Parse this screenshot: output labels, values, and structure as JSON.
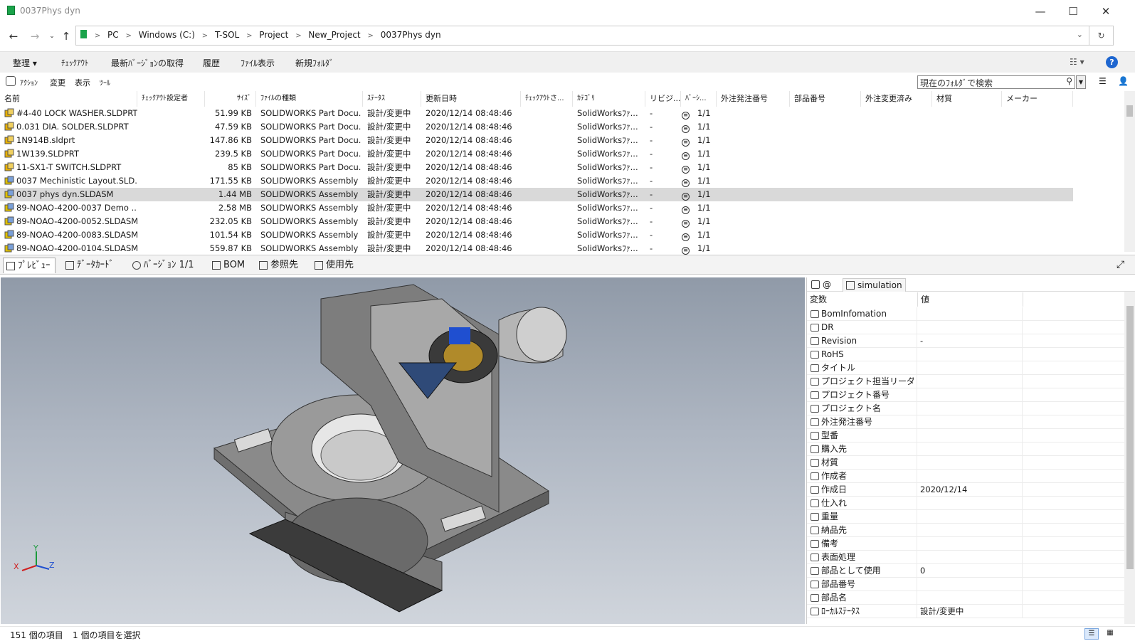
{
  "window": {
    "title": "0037Phys dyn",
    "minimize": "—",
    "maximize": "☐",
    "close": "✕"
  },
  "address": {
    "crumbs": [
      "PC",
      "Windows (C:)",
      "T-SOL",
      "Project",
      "New_Project",
      "0037Phys dyn"
    ]
  },
  "toolbar": {
    "organize": "整理",
    "checkout": "ﾁｪｯｸｱｳﾄ",
    "get_latest": "最新ﾊﾞｰｼﾞｮﾝの取得",
    "history": "履歴",
    "file_view": "ﾌｧｲﾙ表示",
    "new_folder": "新規ﾌｫﾙﾀﾞ",
    "help": "?"
  },
  "menu": {
    "action": "ｱｸｼｮﾝ",
    "modify": "変更",
    "display": "表示",
    "tool": "ﾂｰﾙ",
    "search_placeholder": "現在のﾌｫﾙﾀﾞで検索"
  },
  "columns": [
    "名前",
    "ﾁｪｯｸｱｳﾄ設定者",
    "ｻｲｽﾞ",
    "ﾌｧｲﾙの種類",
    "ｽﾃｰﾀｽ",
    "更新日時",
    "ﾁｪｯｸｱｳﾄさ...",
    "ｶﾃｺﾞﾘ",
    "リビジ...",
    "ﾊﾞｰｼ...",
    "外注発注番号",
    "部品番号",
    "外注変更済み",
    "材質",
    "メーカー"
  ],
  "files": [
    {
      "name": "#4-40 LOCK WASHER.SLDPRT",
      "size": "51.99 KB",
      "type": "SOLIDWORKS Part Docu...",
      "status": "設計/変更中",
      "date": "2020/12/14 08:48:46",
      "category": "SolidWorksﾌｧ...",
      "rev": "-",
      "ver": "1/1"
    },
    {
      "name": "0.031 DIA. SOLDER.SLDPRT",
      "size": "47.59 KB",
      "type": "SOLIDWORKS Part Docu...",
      "status": "設計/変更中",
      "date": "2020/12/14 08:48:46",
      "category": "SolidWorksﾌｧ...",
      "rev": "-",
      "ver": "1/1"
    },
    {
      "name": "1N914B.sldprt",
      "size": "147.86 KB",
      "type": "SOLIDWORKS Part Docu...",
      "status": "設計/変更中",
      "date": "2020/12/14 08:48:46",
      "category": "SolidWorksﾌｧ...",
      "rev": "-",
      "ver": "1/1"
    },
    {
      "name": "1W139.SLDPRT",
      "size": "239.5 KB",
      "type": "SOLIDWORKS Part Docu...",
      "status": "設計/変更中",
      "date": "2020/12/14 08:48:46",
      "category": "SolidWorksﾌｧ...",
      "rev": "-",
      "ver": "1/1"
    },
    {
      "name": "11-SX1-T SWITCH.SLDPRT",
      "size": "85 KB",
      "type": "SOLIDWORKS Part Docu...",
      "status": "設計/変更中",
      "date": "2020/12/14 08:48:46",
      "category": "SolidWorksﾌｧ...",
      "rev": "-",
      "ver": "1/1"
    },
    {
      "name": "0037 Mechinistic Layout.SLD...",
      "size": "171.55 KB",
      "type": "SOLIDWORKS Assembly ...",
      "status": "設計/変更中",
      "date": "2020/12/14 08:48:46",
      "category": "SolidWorksﾌｧ...",
      "rev": "-",
      "ver": "1/1"
    },
    {
      "name": "0037 phys dyn.SLDASM",
      "size": "1.44 MB",
      "type": "SOLIDWORKS Assembly ...",
      "status": "設計/変更中",
      "date": "2020/12/14 08:48:46",
      "category": "SolidWorksﾌｧ...",
      "rev": "-",
      "ver": "1/1"
    },
    {
      "name": "89-NOAO-4200-0037 Demo ...",
      "size": "2.58 MB",
      "type": "SOLIDWORKS Assembly ...",
      "status": "設計/変更中",
      "date": "2020/12/14 08:48:46",
      "category": "SolidWorksﾌｧ...",
      "rev": "-",
      "ver": "1/1"
    },
    {
      "name": "89-NOAO-4200-0052.SLDASM",
      "size": "232.05 KB",
      "type": "SOLIDWORKS Assembly ...",
      "status": "設計/変更中",
      "date": "2020/12/14 08:48:46",
      "category": "SolidWorksﾌｧ...",
      "rev": "-",
      "ver": "1/1"
    },
    {
      "name": "89-NOAO-4200-0083.SLDASM",
      "size": "101.54 KB",
      "type": "SOLIDWORKS Assembly ...",
      "status": "設計/変更中",
      "date": "2020/12/14 08:48:46",
      "category": "SolidWorksﾌｧ...",
      "rev": "-",
      "ver": "1/1"
    },
    {
      "name": "89-NOAO-4200-0104.SLDASM",
      "size": "559.87 KB",
      "type": "SOLIDWORKS Assembly ...",
      "status": "設計/変更中",
      "date": "2020/12/14 08:48:46",
      "category": "SolidWorksﾌｧ...",
      "rev": "-",
      "ver": "1/1"
    }
  ],
  "tabs": [
    "ﾌﾟﾚﾋﾞｭｰ",
    "ﾃﾞｰﾀｶｰﾄﾞ",
    "ﾊﾞｰｼﾞｮﾝ 1/1",
    "BOM",
    "参照先",
    "使用先"
  ],
  "props": {
    "tab_at": "@",
    "tab_sim": "simulation",
    "head_var": "変数",
    "head_val": "値",
    "rows": [
      {
        "k": "BomInfomation",
        "v": ""
      },
      {
        "k": "DR",
        "v": ""
      },
      {
        "k": "Revision",
        "v": "-"
      },
      {
        "k": "RoHS",
        "v": ""
      },
      {
        "k": "タイトル",
        "v": ""
      },
      {
        "k": "プロジェクト担当リーダー",
        "v": ""
      },
      {
        "k": "プロジェクト番号",
        "v": ""
      },
      {
        "k": "プロジェクト名",
        "v": ""
      },
      {
        "k": "外注発注番号",
        "v": ""
      },
      {
        "k": "型番",
        "v": ""
      },
      {
        "k": "購入先",
        "v": ""
      },
      {
        "k": "材質",
        "v": ""
      },
      {
        "k": "作成者",
        "v": ""
      },
      {
        "k": "作成日",
        "v": "2020/12/14"
      },
      {
        "k": "仕入れ",
        "v": ""
      },
      {
        "k": "重量",
        "v": ""
      },
      {
        "k": "納品先",
        "v": ""
      },
      {
        "k": "備考",
        "v": ""
      },
      {
        "k": "表面処理",
        "v": ""
      },
      {
        "k": "部品として使用",
        "v": "0"
      },
      {
        "k": "部品番号",
        "v": ""
      },
      {
        "k": "部品名",
        "v": ""
      },
      {
        "k": "ﾛｰｶﾙｽﾃｰﾀｽ",
        "v": "設計/変更中"
      }
    ]
  },
  "status": {
    "count": "151 個の項目",
    "selected": "1 個の項目を選択"
  },
  "axes": {
    "x": "X",
    "y": "Y",
    "z": "Z"
  }
}
